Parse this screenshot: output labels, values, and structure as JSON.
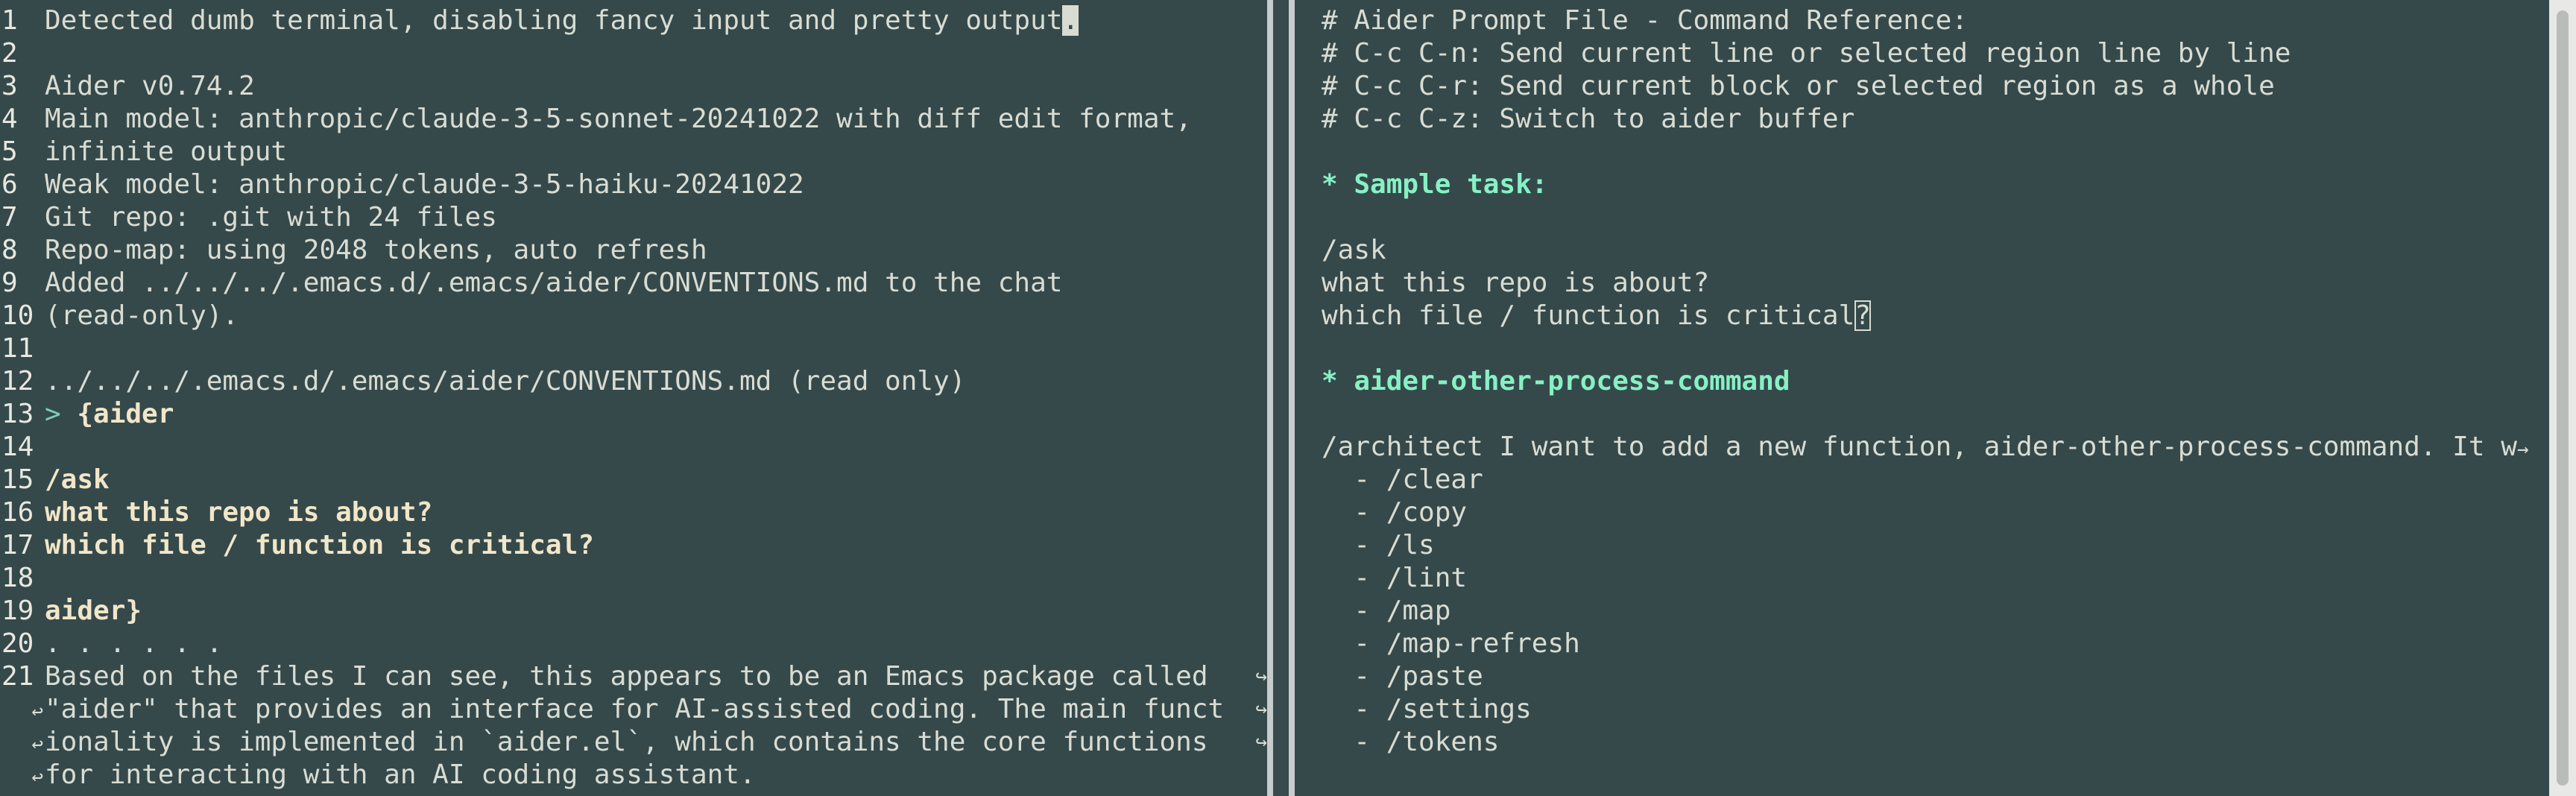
{
  "left": {
    "lines": [
      {
        "n": "1",
        "text": "Detected dumb terminal, disabling fancy input and pretty output",
        "cursor": "."
      },
      {
        "n": "2",
        "text": ""
      },
      {
        "n": "3",
        "text": "Aider v0.74.2"
      },
      {
        "n": "4",
        "text": "Main model: anthropic/claude-3-5-sonnet-20241022 with diff edit format,"
      },
      {
        "n": "5",
        "text": "infinite output"
      },
      {
        "n": "6",
        "text": "Weak model: anthropic/claude-3-5-haiku-20241022"
      },
      {
        "n": "7",
        "text": "Git repo: .git with 24 files"
      },
      {
        "n": "8",
        "text": "Repo-map: using 2048 tokens, auto refresh"
      },
      {
        "n": "9",
        "text": "Added ../../../.emacs.d/.emacs/aider/CONVENTIONS.md to the chat"
      },
      {
        "n": "10",
        "text": "(read-only)."
      },
      {
        "n": "11",
        "text": ""
      },
      {
        "n": "12",
        "text": "../../../.emacs.d/.emacs/aider/CONVENTIONS.md (read only)"
      },
      {
        "n": "13",
        "prompt": "> ",
        "text": "{aider"
      },
      {
        "n": "14",
        "text": ""
      },
      {
        "n": "15",
        "text": "/ask"
      },
      {
        "n": "16",
        "text": "what this repo is about?"
      },
      {
        "n": "17",
        "text": "which file / function is critical?"
      },
      {
        "n": "18",
        "text": ""
      },
      {
        "n": "19",
        "text": "aider}"
      },
      {
        "n": "20",
        "text": ". . . . . ."
      },
      {
        "n": "21",
        "text": "Based on the files I can see, this appears to be an Emacs package called "
      },
      {
        "n": "",
        "text": "\"aider\" that provides an interface for AI-assisted coding. The main funct"
      },
      {
        "n": "",
        "text": "ionality is implemented in `aider.el`, which contains the core functions "
      },
      {
        "n": "",
        "text": "for interacting with an AI coding assistant."
      }
    ]
  },
  "right": {
    "lines": [
      "# Aider Prompt File - Command Reference:",
      "# C-c C-n: Send current line or selected region line by line",
      "# C-c C-r: Send current block or selected region as a whole",
      "# C-c C-z: Switch to aider buffer",
      "",
      "* Sample task:",
      "",
      "/ask",
      "what this repo is about?",
      "which file / function is critical",
      "",
      "* aider-other-process-command",
      "",
      "/architect I want to add a new function, aider-other-process-command. It w",
      "  - /clear",
      "  - /copy",
      "  - /ls",
      "  - /lint",
      "  - /map",
      "  - /map-refresh",
      "  - /paste",
      "  - /settings",
      "  - /tokens"
    ],
    "cursor_char": "?",
    "truncation_mark": "→",
    "wrap_mark": "↩",
    "continuation_mark": "↪"
  }
}
